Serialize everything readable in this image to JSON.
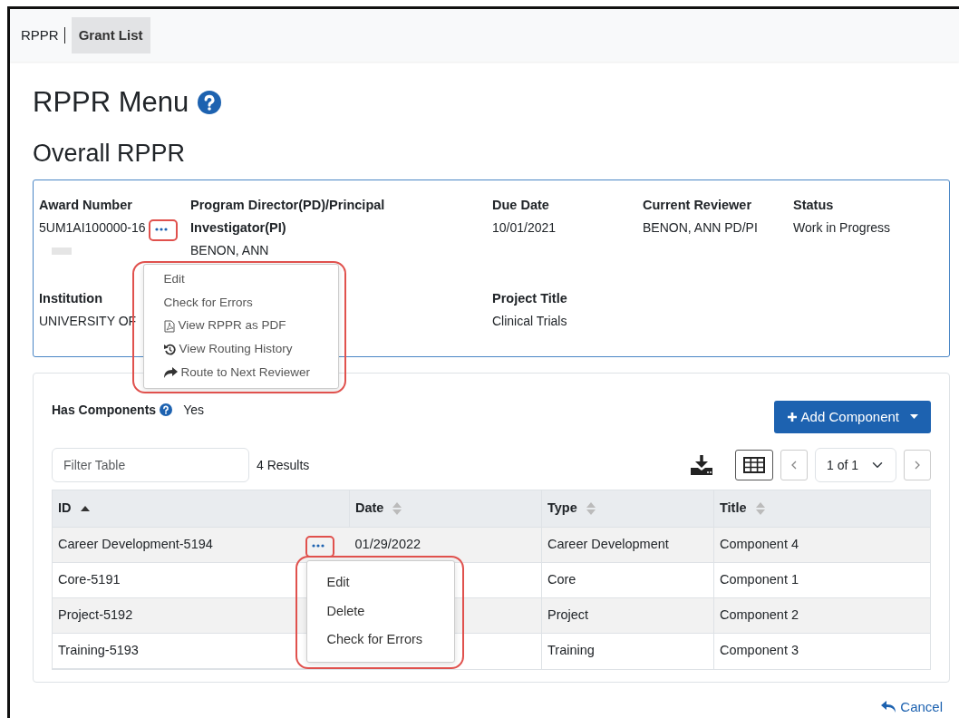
{
  "nav": {
    "brand": "RPPR",
    "items": [
      {
        "label": "Grant List",
        "selected": true
      }
    ]
  },
  "page_title": "RPPR Menu",
  "section_title": "Overall RPPR",
  "award_fields": [
    {
      "label": "Award Number",
      "value": "5UM1AI100000-16",
      "kind": "award"
    },
    {
      "label": "Program Director(PD)/Principal Investigator(PI)",
      "value": "BENON, ANN",
      "kind": "text"
    },
    {
      "label": "Due Date",
      "value": "10/01/2021",
      "kind": "text"
    },
    {
      "label": "Current Reviewer",
      "value": "BENON,  ANN PD/PI",
      "kind": "text"
    },
    {
      "label": "Status",
      "value": "Work in Progress",
      "kind": "text"
    },
    {
      "label": "Institution",
      "value": "UNIVERSITY OF",
      "kind": "text"
    },
    {
      "label": "Project Title",
      "value": "Clinical Trials",
      "kind": "text"
    }
  ],
  "award_menu": [
    {
      "label": "Edit",
      "kind": "plain"
    },
    {
      "label": "Check for Errors",
      "kind": "plain"
    },
    {
      "label": "View RPPR as PDF",
      "kind": "pdf"
    },
    {
      "label": "View Routing History",
      "kind": "history"
    },
    {
      "label": "Route to Next Reviewer",
      "kind": "share"
    }
  ],
  "components": {
    "label": "Has Components",
    "value": "Yes",
    "add_button": "Add Component",
    "filter": {
      "placeholder": "Filter Table"
    },
    "results": "4 Results",
    "pager": "1 of 1",
    "columns": [
      {
        "label": "ID",
        "sorted": true
      },
      {
        "label": "Date",
        "sorted": false
      },
      {
        "label": "Type",
        "sorted": false
      },
      {
        "label": "Title",
        "sorted": false
      }
    ],
    "rows": [
      {
        "cells": [
          "Career Development-5194",
          "01/29/2022",
          "Career Development",
          "Component 4"
        ],
        "menu": [
          "Edit",
          "Delete",
          "Check for Errors"
        ]
      },
      {
        "cells": [
          "Core-5191",
          "",
          "Core",
          "Component 1"
        ]
      },
      {
        "cells": [
          "Project-5192",
          "",
          "Project",
          "Component 2"
        ]
      },
      {
        "cells": [
          "Training-5193",
          "",
          "Training",
          "Component 3"
        ]
      }
    ]
  },
  "cancel": "Cancel"
}
